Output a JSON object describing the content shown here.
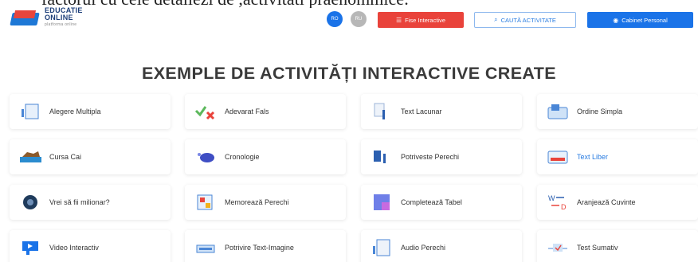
{
  "cut_text": "factorul cu cele detaliezi de ,activitati praenommice:",
  "logo": {
    "line1": "EDUCATIE",
    "line2": "ONLINE",
    "line3": "platforma online"
  },
  "languages": [
    "RO",
    "RU"
  ],
  "nav": {
    "fise": "Fise Interactive",
    "cauta": "CAUTĂ ACTIVITATE",
    "cabinet": "Cabinet Personal"
  },
  "page_title": "EXEMPLE DE ACTIVITĂȚI INTERACTIVE CREATE",
  "activities": [
    {
      "label": "Alegere Multipla",
      "icon": "multiple-choice-icon"
    },
    {
      "label": "Adevarat Fals",
      "icon": "true-false-icon"
    },
    {
      "label": "Text Lacunar",
      "icon": "text-gap-icon"
    },
    {
      "label": "Ordine Simpla",
      "icon": "simple-order-icon"
    },
    {
      "label": "Cursa Cai",
      "icon": "horse-race-icon"
    },
    {
      "label": "Cronologie",
      "icon": "timeline-icon"
    },
    {
      "label": "Potriveste Perechi",
      "icon": "match-pairs-icon"
    },
    {
      "label": "Text Liber",
      "icon": "free-text-icon"
    },
    {
      "label": "Vrei să fii milionar?",
      "icon": "millionaire-icon"
    },
    {
      "label": "Memorează Perechi",
      "icon": "memory-pairs-icon"
    },
    {
      "label": "Completează Tabel",
      "icon": "complete-table-icon"
    },
    {
      "label": "Aranjează Cuvinte",
      "icon": "arrange-words-icon"
    },
    {
      "label": "Video Interactiv",
      "icon": "video-icon"
    },
    {
      "label": "Potrivire Text-Imagine",
      "icon": "text-image-icon"
    },
    {
      "label": "Audio Perechi",
      "icon": "audio-pairs-icon"
    },
    {
      "label": "Test Sumativ",
      "icon": "summative-test-icon"
    }
  ],
  "colors": {
    "primary": "#1a73e8",
    "accent_red": "#e9433b",
    "title": "#3a3a3a"
  }
}
